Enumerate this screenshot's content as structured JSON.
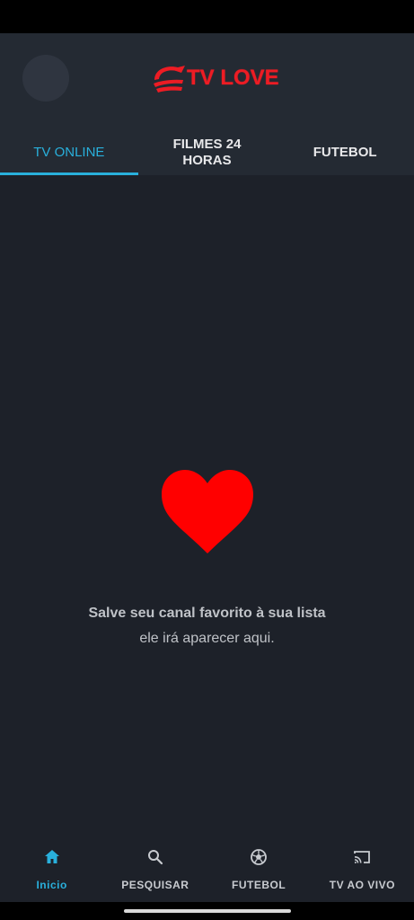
{
  "app": {
    "name": "TV LOVE",
    "brand_color": "#ed1c24",
    "accent_color": "#29b0dc",
    "logo_icon": "tv-love-logo-mark"
  },
  "tabs": [
    {
      "label": "TV ONLINE",
      "active": true
    },
    {
      "label": "FILMES 24 HORAS",
      "active": false
    },
    {
      "label": "FUTEBOL",
      "active": false
    }
  ],
  "empty_state": {
    "icon": "heart-icon",
    "title": "Salve seu canal favorito à sua lista",
    "subtitle": "ele irá aparecer aqui."
  },
  "bottom_nav": [
    {
      "label": "Inicio",
      "icon": "home-icon",
      "active": true
    },
    {
      "label": "PESQUISAR",
      "icon": "search-icon",
      "active": false
    },
    {
      "label": "FUTEBOL",
      "icon": "soccer-ball-icon",
      "active": false
    },
    {
      "label": "TV AO VIVO",
      "icon": "cast-icon",
      "active": false
    }
  ]
}
